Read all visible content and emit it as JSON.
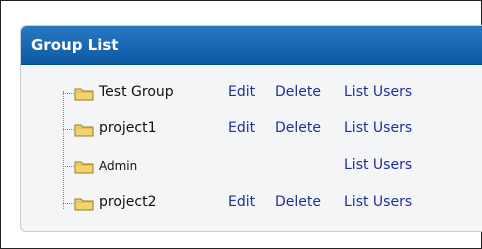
{
  "panel": {
    "title": "Group List"
  },
  "groups": [
    {
      "name": "Test Group",
      "edit": "Edit",
      "delete": "Delete",
      "list_users": "List Users"
    },
    {
      "name": "project1",
      "edit": "Edit",
      "delete": "Delete",
      "list_users": "List Users"
    },
    {
      "name": "Admin",
      "edit": "",
      "delete": "",
      "list_users": "List Users"
    },
    {
      "name": "project2",
      "edit": "Edit",
      "delete": "Delete",
      "list_users": "List Users"
    }
  ],
  "icons": {
    "group": "folder-icon"
  },
  "colors": {
    "header": "#1465b3",
    "link": "#1f2f9b",
    "panel_bg": "#f4f5f6"
  }
}
